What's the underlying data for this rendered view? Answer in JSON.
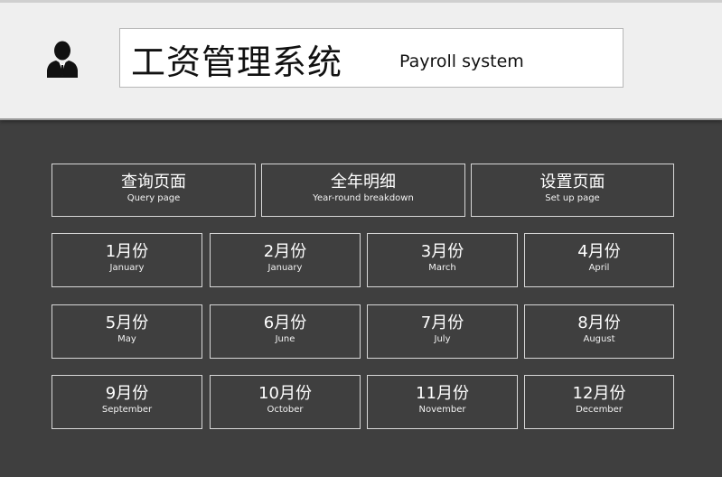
{
  "header": {
    "title_cn": "工资管理系统",
    "title_en": "Payroll system",
    "user_icon": "user-icon"
  },
  "nav": [
    {
      "cn": "查询页面",
      "en": "Query page"
    },
    {
      "cn": "全年明细",
      "en": "Year-round breakdown"
    },
    {
      "cn": "设置页面",
      "en": "Set up page"
    }
  ],
  "months": [
    {
      "cn": "1月份",
      "en": "January"
    },
    {
      "cn": "2月份",
      "en": "January"
    },
    {
      "cn": "3月份",
      "en": "March"
    },
    {
      "cn": "4月份",
      "en": "April"
    },
    {
      "cn": "5月份",
      "en": "May"
    },
    {
      "cn": "6月份",
      "en": "June"
    },
    {
      "cn": "7月份",
      "en": "July"
    },
    {
      "cn": "8月份",
      "en": "August"
    },
    {
      "cn": "9月份",
      "en": "September"
    },
    {
      "cn": "10月份",
      "en": "October"
    },
    {
      "cn": "11月份",
      "en": "November"
    },
    {
      "cn": "12月份",
      "en": "December"
    }
  ],
  "colors": {
    "background": "#3f3f3f",
    "header": "#efefef",
    "button_border": "#d8d8d8",
    "button_text": "#ffffff"
  }
}
